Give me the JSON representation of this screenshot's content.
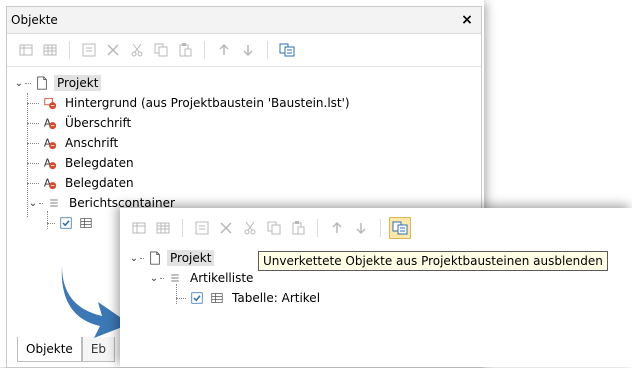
{
  "back_panel": {
    "title": "Objekte",
    "close_glyph": "×",
    "tree": {
      "root": "Projekt",
      "items": [
        "Hintergrund (aus Projektbaustein 'Baustein.lst')",
        "Überschrift",
        "Anschrift",
        "Belegdaten",
        "Belegdaten",
        "Berichtscontainer"
      ]
    },
    "tabs": [
      "Objekte",
      "Eb"
    ]
  },
  "front_panel": {
    "tree": {
      "root": "Projekt",
      "list": "Artikelliste",
      "table": "Tabelle: Artikel"
    },
    "tooltip": "Unverkettete Objekte aus Projektbausteinen ausblenden"
  },
  "colors": {
    "arrow": "#3b78b5",
    "highlight": "#fbe7a8",
    "object_icon_red": "#d9472b"
  }
}
